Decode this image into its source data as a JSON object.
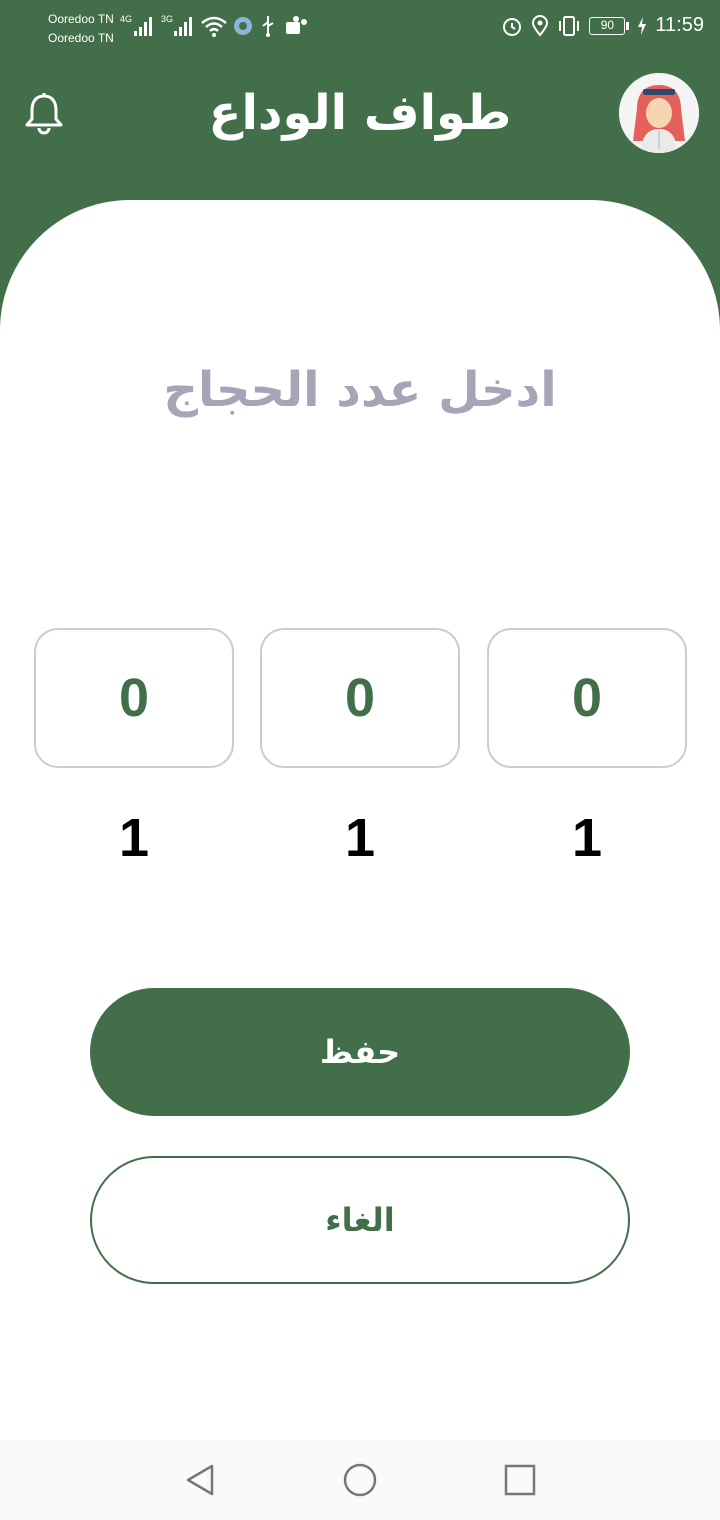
{
  "status_bar": {
    "carrier_1": "Ooredoo TN",
    "carrier_2": "Ooredoo TN",
    "net_1": "4G",
    "net_2": "3G",
    "battery": "90",
    "time": "11:59"
  },
  "header": {
    "title": "طواف الوداع",
    "bell_icon": "bell-icon",
    "avatar_icon": "user-avatar"
  },
  "main": {
    "prompt": "ادخل عدد الحجاج",
    "counters": [
      {
        "value": "0",
        "label": "1"
      },
      {
        "value": "0",
        "label": "1"
      },
      {
        "value": "0",
        "label": "1"
      }
    ],
    "save_label": "حفظ",
    "cancel_label": "الغاء"
  },
  "colors": {
    "primary": "#426F4A",
    "prompt": "#A6A4B6",
    "box_border": "#CDCDCD"
  }
}
